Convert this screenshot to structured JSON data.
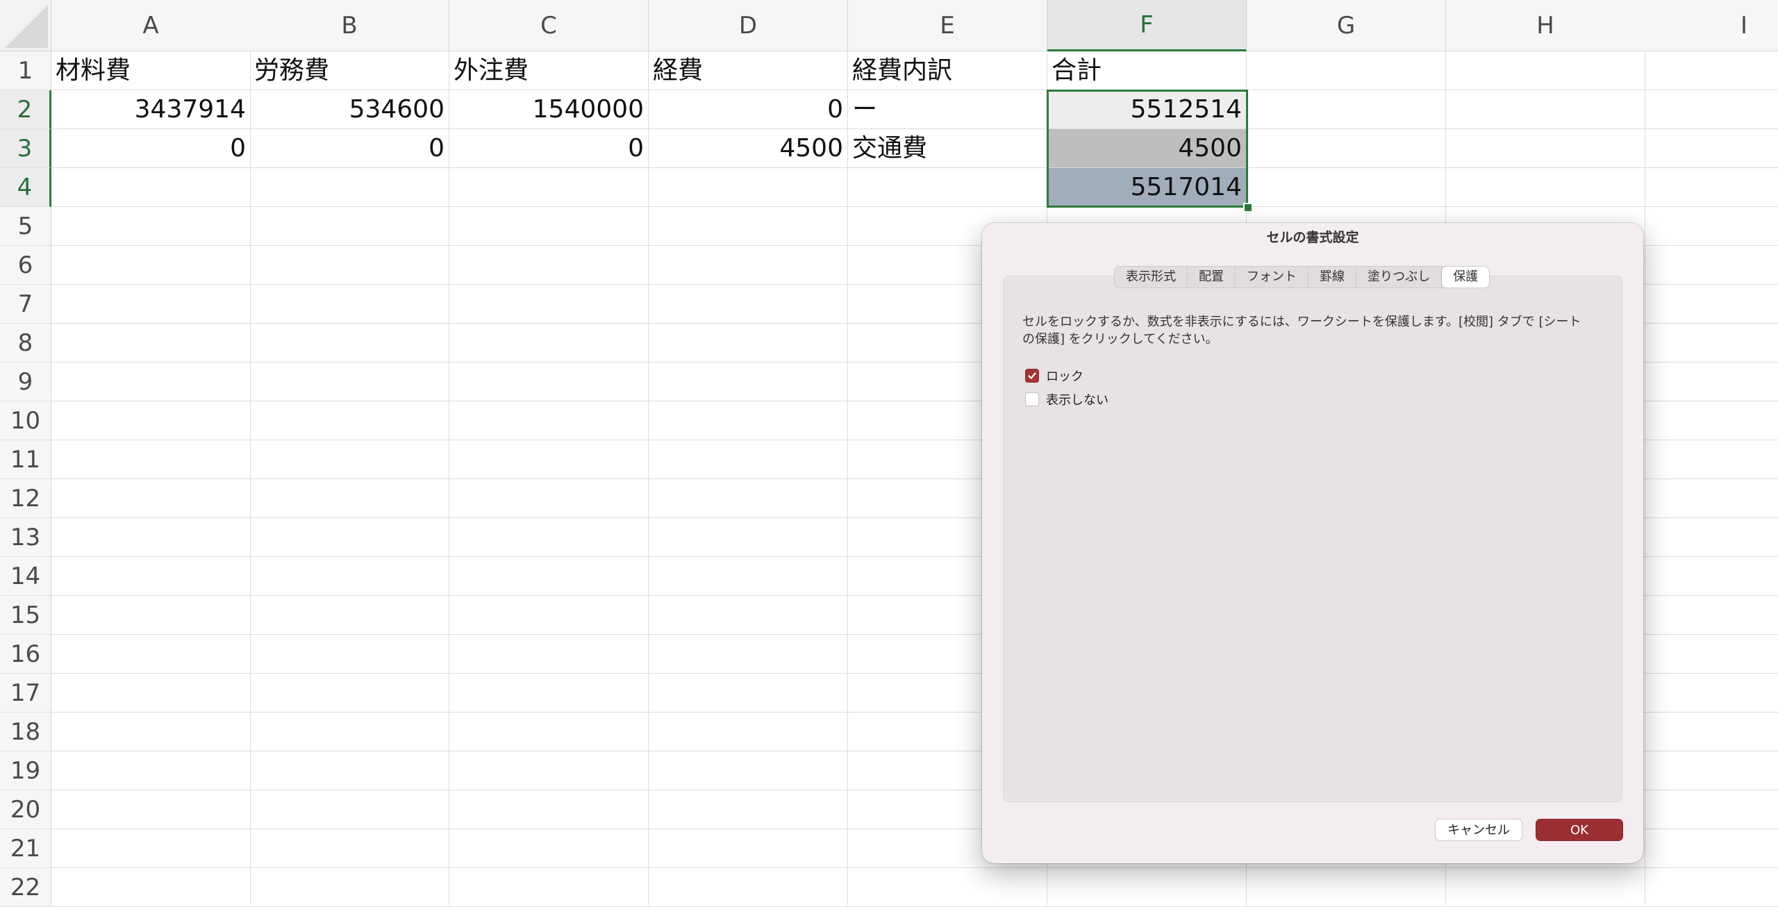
{
  "sheet": {
    "columns": [
      "A",
      "B",
      "C",
      "D",
      "E",
      "F",
      "G",
      "H",
      "I"
    ],
    "selected_column": "F",
    "rows": [
      "1",
      "2",
      "3",
      "4",
      "5",
      "6",
      "7",
      "8",
      "9",
      "10",
      "11",
      "12",
      "13",
      "14",
      "15",
      "16",
      "17",
      "18",
      "19",
      "20",
      "21",
      "22"
    ],
    "selected_rows": [
      "2",
      "3",
      "4"
    ],
    "cells": {
      "A1": "材料費",
      "B1": "労務費",
      "C1": "外注費",
      "D1": "経費",
      "E1": "経費内訳",
      "F1": "合計",
      "A2": "3437914",
      "B2": "534600",
      "C2": "1540000",
      "D2": "0",
      "E2": "ー",
      "F2": "5512514",
      "A3": "0",
      "B3": "0",
      "C3": "0",
      "D3": "4500",
      "E3": "交通費",
      "F3": "4500",
      "F4": "5517014"
    },
    "fill_colors": {
      "F2": "#ededed",
      "F3": "#bebebe",
      "F4": "#a2adba"
    },
    "selection_color": "#2d7a3d"
  },
  "dialog": {
    "title": "セルの書式設定",
    "tabs": [
      {
        "label": "表示形式"
      },
      {
        "label": "配置"
      },
      {
        "label": "フォント"
      },
      {
        "label": "罫線"
      },
      {
        "label": "塗りつぶし"
      },
      {
        "label": "保護"
      }
    ],
    "active_tab": "保護",
    "description": "セルをロックするか、数式を非表示にするには、ワークシートを保護します。[校閲] タブで [シートの保護] をクリックしてください。",
    "lock": {
      "label": "ロック",
      "checked": true
    },
    "hidden": {
      "label": "表示しない",
      "checked": false
    },
    "cancel_label": "キャンセル",
    "ok_label": "OK",
    "accent_color": "#9a2f33"
  }
}
